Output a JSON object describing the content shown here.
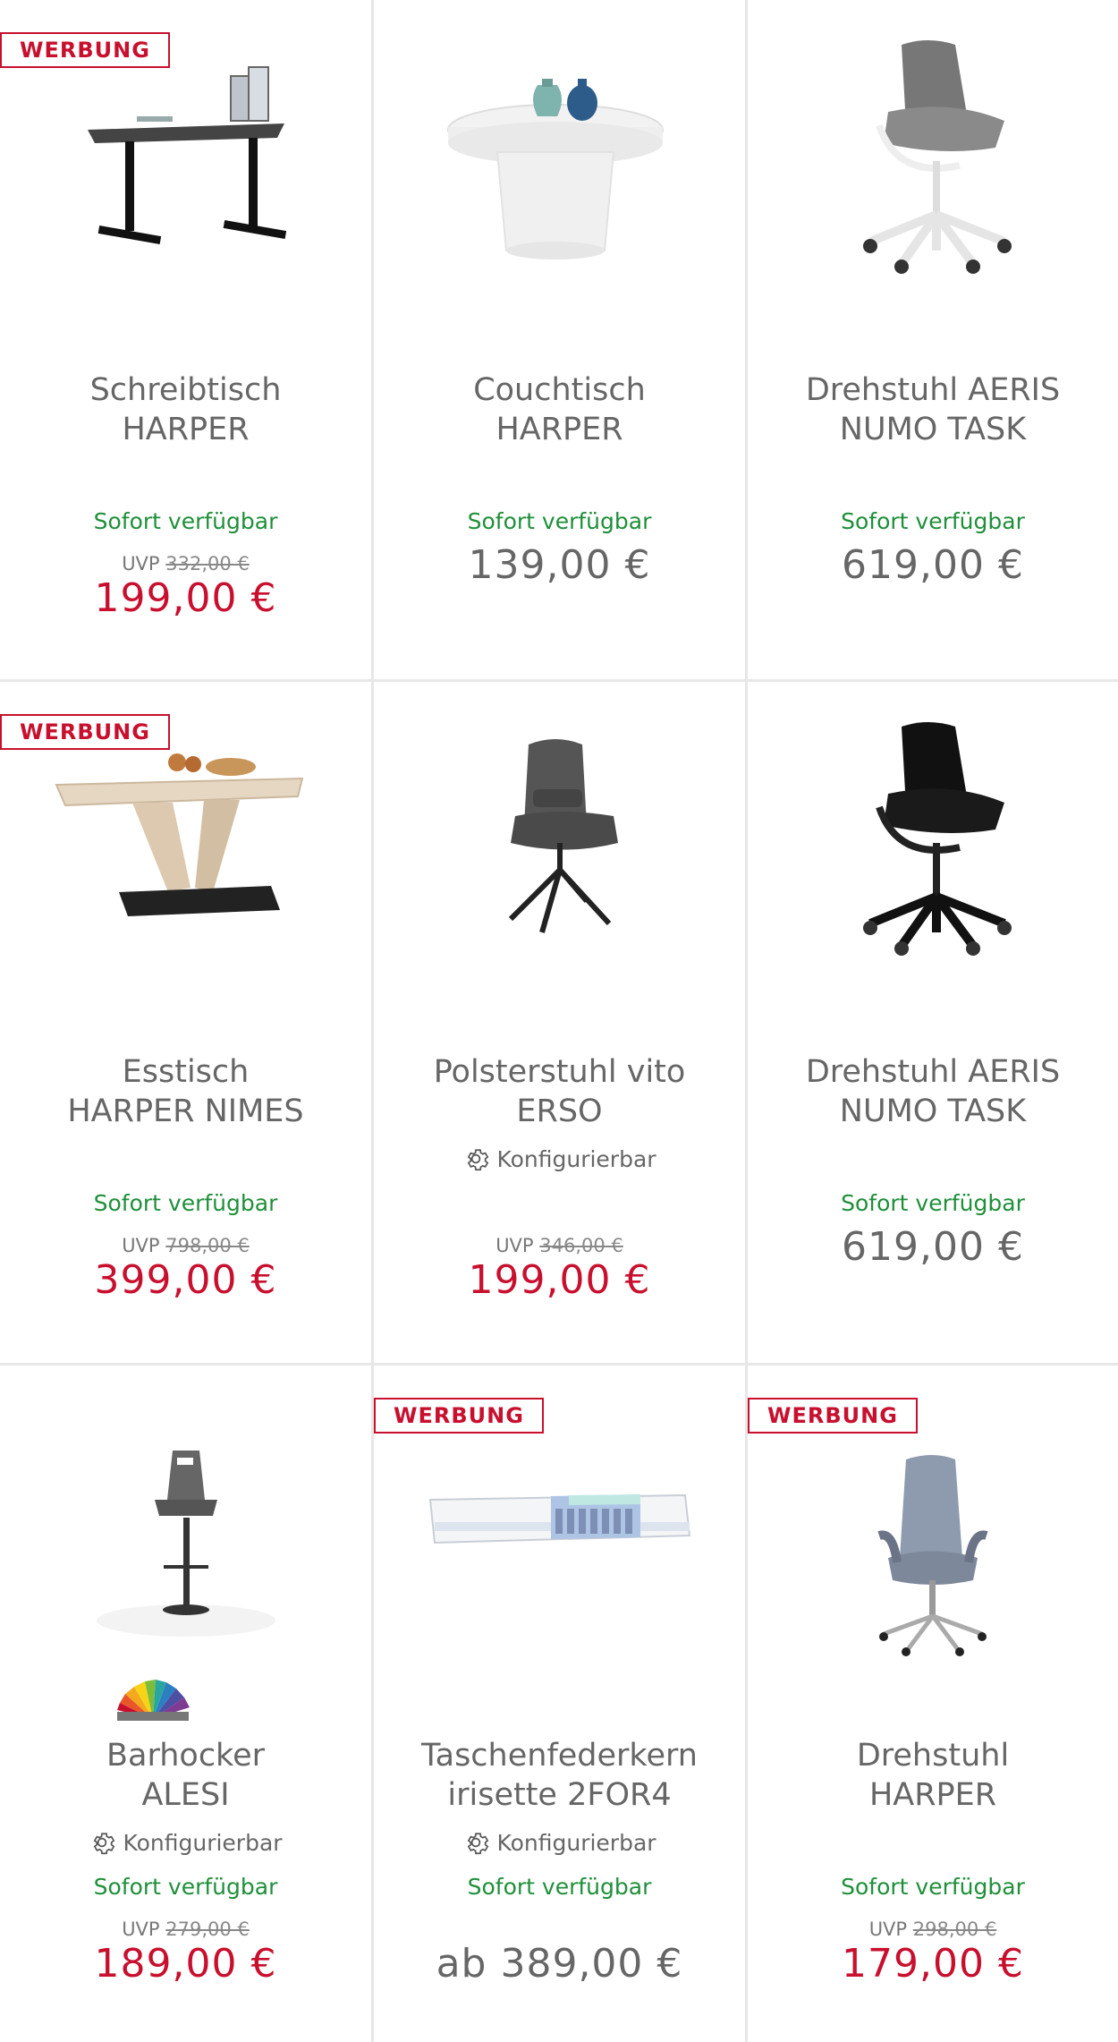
{
  "badge_label": "WERBUNG",
  "konfig_label": "Konfigurierbar",
  "uvp_prefix": "UVP",
  "products": [
    {
      "title1": "Schreibtisch",
      "title2": "HARPER",
      "availability": "Sofort verfügbar",
      "uvp": "332,00 €",
      "price": "199,00 €"
    },
    {
      "title1": "Couchtisch",
      "title2": "HARPER",
      "availability": "Sofort verfügbar",
      "price": "139,00 €"
    },
    {
      "title1": "Drehstuhl AERIS",
      "title2": "NUMO TASK",
      "availability": "Sofort verfügbar",
      "price": "619,00 €"
    },
    {
      "title1": "Esstisch",
      "title2": "HARPER NIMES",
      "availability": "Sofort verfügbar",
      "uvp": "798,00 €",
      "price": "399,00 €"
    },
    {
      "title1": "Polsterstuhl vito",
      "title2": "ERSO",
      "uvp": "346,00 €",
      "price": "199,00 €"
    },
    {
      "title1": "Drehstuhl AERIS",
      "title2": "NUMO TASK",
      "availability": "Sofort verfügbar",
      "price": "619,00 €"
    },
    {
      "title1": "Barhocker",
      "title2": "ALESI",
      "availability": "Sofort verfügbar",
      "uvp": "279,00 €",
      "price": "189,00 €"
    },
    {
      "title1": "Taschenfederkern",
      "title2": "irisette 2FOR4",
      "availability": "Sofort verfügbar",
      "price": "ab 389,00 €"
    },
    {
      "title1": "Drehstuhl",
      "title2": "HARPER",
      "availability": "Sofort verfügbar",
      "uvp": "298,00 €",
      "price": "179,00 €"
    }
  ],
  "colors": {
    "sale": "#c8102e",
    "available": "#1f8f3a",
    "text": "#666666",
    "border": "#e7e7e7"
  },
  "icons": [
    "gear-icon",
    "color-palette-icon"
  ]
}
